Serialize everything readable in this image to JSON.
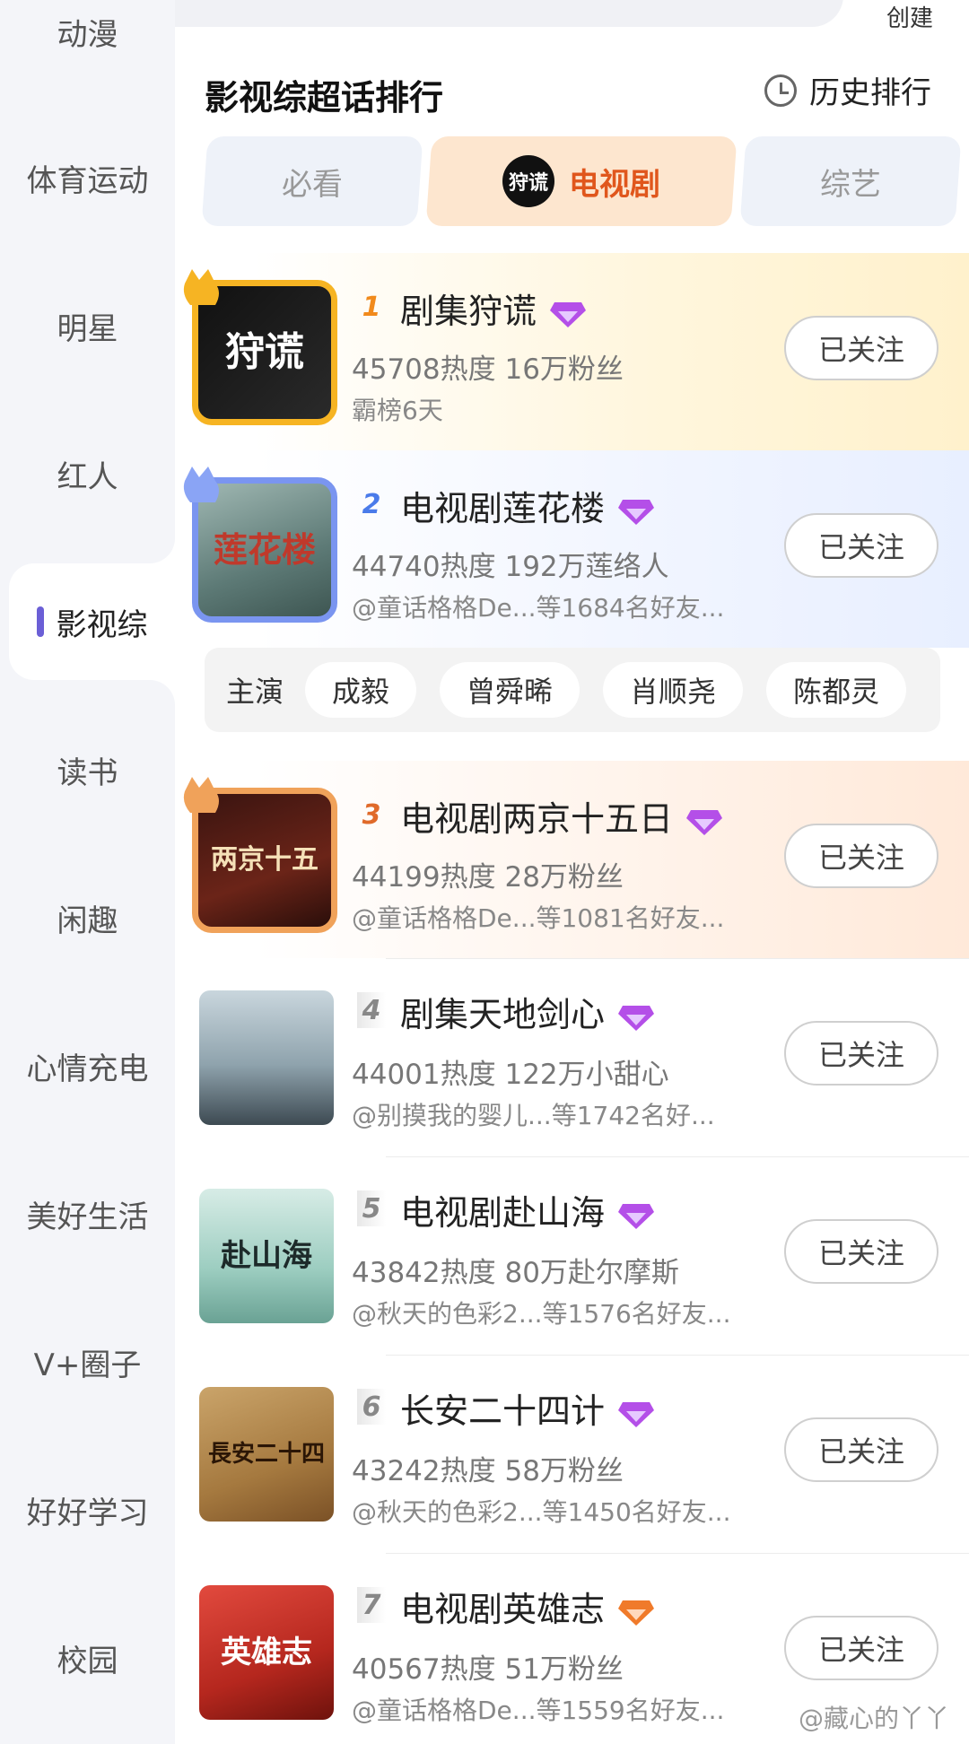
{
  "header": {
    "create_label": "创建",
    "title": "影视综超话排行",
    "history_label": "历史排行"
  },
  "sidebar": {
    "items": [
      {
        "label": "动漫"
      },
      {
        "label": "体育运动"
      },
      {
        "label": "明星"
      },
      {
        "label": "红人"
      },
      {
        "label": "影视综",
        "active": true
      },
      {
        "label": "读书"
      },
      {
        "label": "闲趣"
      },
      {
        "label": "心情充电"
      },
      {
        "label": "美好生活"
      },
      {
        "label": "V+圈子"
      },
      {
        "label": "好好学习"
      },
      {
        "label": "校园"
      }
    ]
  },
  "tabs": [
    {
      "label": "必看",
      "active": false
    },
    {
      "label": "电视剧",
      "active": true,
      "logo_text": "狩谎"
    },
    {
      "label": "综艺",
      "active": false
    }
  ],
  "rankings": [
    {
      "rank": "1",
      "name": "剧集狩谎",
      "stats": "45708热度 16万粉丝",
      "sub": "霸榜6天",
      "follow": "已关注",
      "poster_text": "狩谎",
      "gem": "purple"
    },
    {
      "rank": "2",
      "name": "电视剧莲花楼",
      "stats": "44740热度 192万莲络人",
      "sub": "@童话格格De...等1684名好友...",
      "follow": "已关注",
      "poster_text": "莲花楼",
      "gem": "purple"
    },
    {
      "rank": "3",
      "name": "电视剧两京十五日",
      "stats": "44199热度 28万粉丝",
      "sub": "@童话格格De...等1081名好友...",
      "follow": "已关注",
      "poster_text": "两京十五日",
      "gem": "purple"
    },
    {
      "rank": "4",
      "name": "剧集天地剑心",
      "stats": "44001热度 122万小甜心",
      "sub": "@别摸我的婴儿...等1742名好...",
      "follow": "已关注",
      "poster_text": "",
      "gem": "purple"
    },
    {
      "rank": "5",
      "name": "电视剧赴山海",
      "stats": "43842热度 80万赴尔摩斯",
      "sub": "@秋天的色彩2...等1576名好友...",
      "follow": "已关注",
      "poster_text": "赴山海",
      "gem": "purple"
    },
    {
      "rank": "6",
      "name": "长安二十四计",
      "stats": "43242热度 58万粉丝",
      "sub": "@秋天的色彩2...等1450名好友...",
      "follow": "已关注",
      "poster_text": "長安二十四計",
      "gem": "purple"
    },
    {
      "rank": "7",
      "name": "电视剧英雄志",
      "stats": "40567热度 51万粉丝",
      "sub": "@童话格格De...等1559名好友...",
      "follow": "已关注",
      "poster_text": "英雄志",
      "gem": "orange"
    }
  ],
  "cast": {
    "label": "主演",
    "members": [
      "成毅",
      "曾舜晞",
      "肖顺尧",
      "陈都灵"
    ]
  },
  "watermark": "@藏心的丫丫",
  "colors": {
    "accent": "#e0561c",
    "sidebar_active_bar": "#6b5fd6",
    "gem_purple": "#b44fe8",
    "gem_orange": "#f07a2a"
  }
}
